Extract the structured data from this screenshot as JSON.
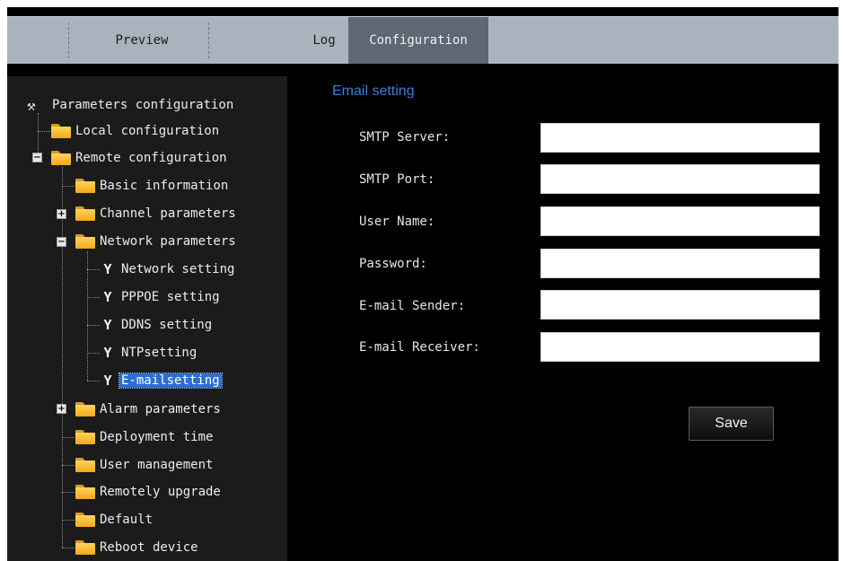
{
  "tabs": [
    {
      "label": "Preview"
    },
    {
      "label": "Log"
    },
    {
      "label": "Configuration"
    }
  ],
  "tree": {
    "root": "Parameters configuration",
    "local": "Local configuration",
    "remote": "Remote configuration",
    "basic": "Basic information",
    "channel": "Channel parameters",
    "network": "Network parameters",
    "network_setting": "Network setting",
    "pppoe": "PPPOE setting",
    "ddns": "DDNS setting",
    "ntp": "NTPsetting",
    "email": "E-mailsetting",
    "alarm": "Alarm parameters",
    "deployment": "Deployment time",
    "user": "User management",
    "upgrade": "Remotely upgrade",
    "default": "Default",
    "reboot": "Reboot device"
  },
  "form": {
    "title": "Email setting",
    "smtp_server_label": "SMTP Server:",
    "smtp_server_value": "",
    "smtp_port_label": "SMTP Port:",
    "smtp_port_value": "",
    "user_name_label": "User Name:",
    "user_name_value": "",
    "password_label": "Password:",
    "password_value": "",
    "sender_label": "E-mail Sender:",
    "sender_value": "",
    "receiver_label": "E-mail Receiver:",
    "receiver_value": "",
    "save_label": "Save"
  },
  "colors": {
    "tabbar": "#aab3bd",
    "active_tab": "#5d6874",
    "background": "#000000",
    "tree_panel": "#1b1b1b",
    "title_blue": "#3d7fd9",
    "selection": "#2c6fd1"
  }
}
